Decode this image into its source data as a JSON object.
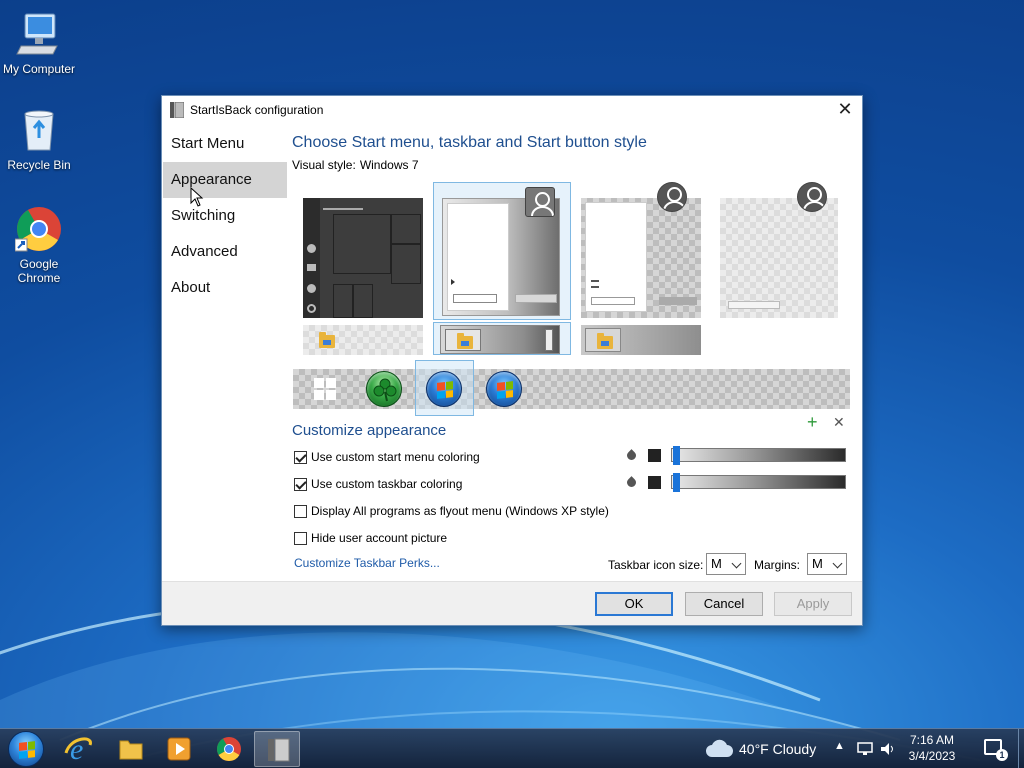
{
  "desktop": {
    "icons": [
      {
        "label": "My Computer",
        "icon": "computer-icon"
      },
      {
        "label": "Recycle Bin",
        "icon": "recycle-bin-icon"
      },
      {
        "label": "Google Chrome",
        "icon": "chrome-icon"
      }
    ]
  },
  "dialog": {
    "title": "StartIsBack configuration",
    "nav": [
      "Start Menu",
      "Appearance",
      "Switching",
      "Advanced",
      "About"
    ],
    "selected_nav": "Appearance",
    "heading": "Choose Start menu, taskbar and Start button style",
    "visual_style_label": "Visual style:",
    "visual_style_value": "Windows 7",
    "customize_heading": "Customize appearance",
    "options": [
      {
        "label": "Use custom start menu coloring",
        "checked": true
      },
      {
        "label": "Use custom taskbar coloring",
        "checked": true
      },
      {
        "label": "Display All programs as flyout menu (Windows XP style)",
        "checked": false
      },
      {
        "label": "Hide user account picture",
        "checked": false
      }
    ],
    "customize_link": "Customize Taskbar Perks...",
    "icon_size_label": "Taskbar icon size:",
    "icon_size_value": "M",
    "margins_label": "Margins:",
    "margins_value": "M",
    "buttons": {
      "ok": "OK",
      "cancel": "Cancel",
      "apply": "Apply"
    },
    "add_symbol": "+",
    "remove_symbol": "✕"
  },
  "taskbar": {
    "weather": "40°F  Cloudy",
    "time": "7:16 AM",
    "date": "3/4/2023",
    "notification_count": "1"
  },
  "colors": {
    "heading": "#1f4f8f",
    "selection": "#7fb8e2",
    "slider_knob": "#1a73d9"
  }
}
